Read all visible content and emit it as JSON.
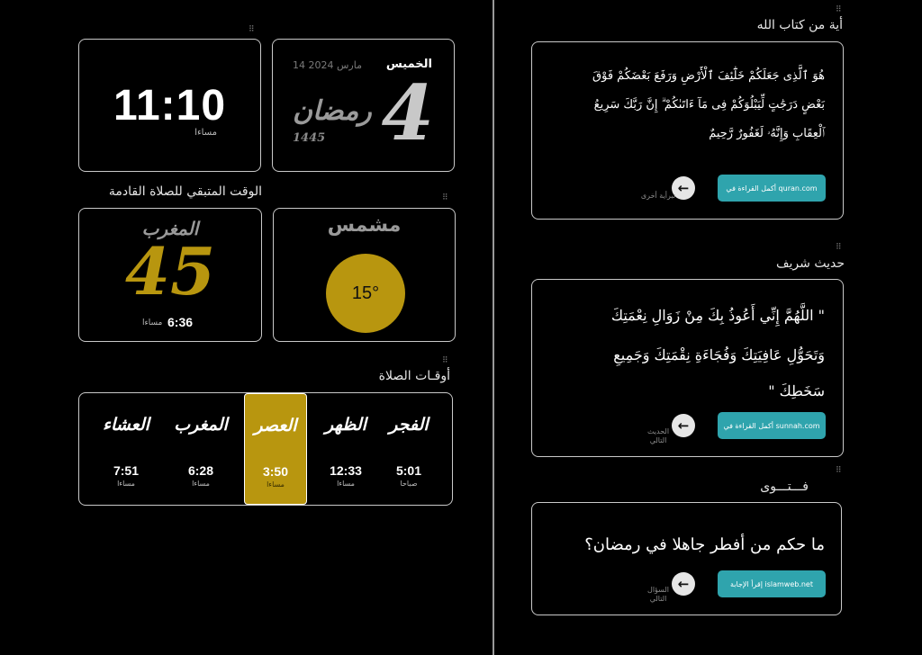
{
  "clock": {
    "time": "11:10",
    "period": "مساءا"
  },
  "date": {
    "weekday": "الخميس",
    "gregorian": "14 مارس 2024",
    "hijri_day": "4",
    "hijri_month": "رمضان",
    "hijri_year": "1445"
  },
  "next_prayer": {
    "title": "الوقت المتبقي للصلاة القادمة",
    "name": "المغرب",
    "minutes_left": "45",
    "time": "6:36",
    "period": "مساءا"
  },
  "weather": {
    "condition": "مشمس",
    "temperature": "15°"
  },
  "prayer_times": {
    "title": "أوقـات الصلاة",
    "items": [
      {
        "name": "الفجر",
        "time": "5:01",
        "period": "صباحا",
        "active": false
      },
      {
        "name": "الظهر",
        "time": "12:33",
        "period": "مساءا",
        "active": false
      },
      {
        "name": "العصر",
        "time": "3:50",
        "period": "مساءا",
        "active": true
      },
      {
        "name": "المغرب",
        "time": "6:28",
        "period": "مساءا",
        "active": false
      },
      {
        "name": "العشاء",
        "time": "7:51",
        "period": "مساءا",
        "active": false
      }
    ]
  },
  "verse_card": {
    "title": "أية من كتاب الله",
    "lines": [
      "هُوَ ٱلَّذِى جَعَلَكُمْ خَلَٰٓئِفَ ٱلْأَرْضِ وَرَفَعَ بَعْضَكُمْ فَوْقَ",
      "بَعْضٍ دَرَجَٰتٍ لِّيَبْلُوَكُمْ فِى مَآ ءَاتَىٰكُمْ ۗ إِنَّ رَبَّكَ سَرِيعُ",
      "ٱلْعِقَابِ وَإِنَّهُۥ لَغَفُورٌ رَّحِيمٌ"
    ],
    "read_button": "أكمل القراءة في quran.com",
    "next_label": "تبرأية أخرى"
  },
  "hadith_card": {
    "title": "حديث شريف",
    "lines": [
      "\" اللَّهُمَّ إِنِّي أَعُوذُ بِكَ مِنْ زَوَالِ نِعْمَتِكَ",
      "وَتَحَوُّلِ عَافِيَتِكَ وَفُجَاءَةِ نِقْمَتِكَ وَجَمِيعِ",
      "سَخَطِكَ \""
    ],
    "read_button": "أكمل القراءة في sunnah.com",
    "next_label": "الحديث التالي"
  },
  "fatwa_card": {
    "title": "فـــتـــوى",
    "question": "ما حكم من أفطر جاهلا في رمضان؟",
    "read_button": "إقرأ الإجابة islamweb.net",
    "next_label": "السؤال التالي"
  },
  "colors": {
    "accent_gold": "#b8960f",
    "teal_button": "#2fa4ad",
    "background": "#000000"
  }
}
